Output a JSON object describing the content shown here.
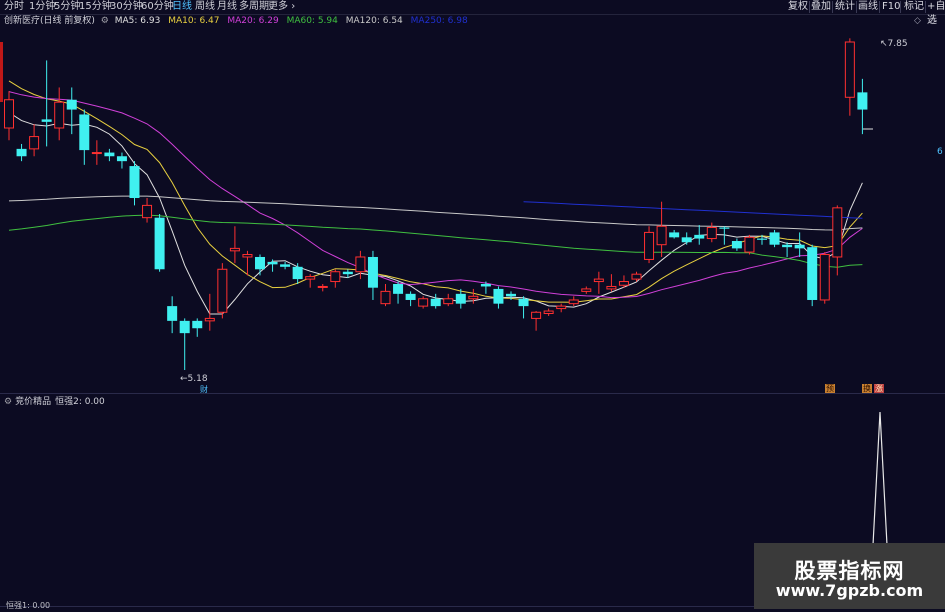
{
  "timeframes": [
    "分时",
    "1分钟",
    "5分钟",
    "15分钟",
    "30分钟",
    "60分钟",
    "日线",
    "周线",
    "月线",
    "多周期",
    "更多"
  ],
  "active_timeframe": "日线",
  "toolbar_right": [
    "复权",
    "叠加",
    "统计",
    "画线",
    "F10",
    "标记",
    "+自选"
  ],
  "title": "创新医疗(日线 前复权)",
  "ma": [
    {
      "label": "MA5: 6.93",
      "color": "#e0e0e0"
    },
    {
      "label": "MA10: 6.47",
      "color": "#e8d040"
    },
    {
      "label": "MA20: 6.29",
      "color": "#d040d8"
    },
    {
      "label": "MA60: 5.94",
      "color": "#40c040"
    },
    {
      "label": "MA120: 6.54",
      "color": "#c8c8c8"
    },
    {
      "label": "MA250: 6.98",
      "color": "#2030d0"
    }
  ],
  "price_high_label": "7.85",
  "price_low_label": "5.18",
  "right_axis_label": "6",
  "event_tag": "财",
  "tags": [
    "预",
    "换",
    "涨"
  ],
  "indicator": {
    "title": "竞价精品",
    "value": "恒强2: 0.00"
  },
  "bottom_text": "恒强1: 0.00",
  "watermark": {
    "line1": "股票指标网",
    "line2": "www.7gpzb.com"
  },
  "colors": {
    "up": "#ff3030",
    "down": "#40f0f0",
    "bg": "#0c0b22"
  },
  "chart_data": {
    "type": "candlestick",
    "candles": [
      [
        7.15,
        7.38,
        7.05,
        7.45
      ],
      [
        6.98,
        6.92,
        6.88,
        7.02
      ],
      [
        6.98,
        7.08,
        6.92,
        7.18
      ],
      [
        7.22,
        7.2,
        7.0,
        7.7
      ],
      [
        7.15,
        7.36,
        7.05,
        7.48
      ],
      [
        7.38,
        7.3,
        7.1,
        7.48
      ],
      [
        7.26,
        6.97,
        6.85,
        7.3
      ],
      [
        6.95,
        6.95,
        6.85,
        7.05
      ],
      [
        6.95,
        6.92,
        6.88,
        6.98
      ],
      [
        6.92,
        6.88,
        6.82,
        6.95
      ],
      [
        6.84,
        6.58,
        6.52,
        6.88
      ],
      [
        6.42,
        6.52,
        6.38,
        6.58
      ],
      [
        6.42,
        6.0,
        5.98,
        6.45
      ],
      [
        5.7,
        5.58,
        5.48,
        5.78
      ],
      [
        5.58,
        5.48,
        5.18,
        5.6
      ],
      [
        5.58,
        5.52,
        5.45,
        5.6
      ],
      [
        5.58,
        5.6,
        5.5,
        5.8
      ],
      [
        5.65,
        6.0,
        5.6,
        6.05
      ],
      [
        6.15,
        6.17,
        6.05,
        6.35
      ],
      [
        6.1,
        6.12,
        5.95,
        6.15
      ],
      [
        6.1,
        6.0,
        5.95,
        6.12
      ],
      [
        6.06,
        6.04,
        5.98,
        6.08
      ],
      [
        6.04,
        6.02,
        6.0,
        6.06
      ],
      [
        6.02,
        5.92,
        5.88,
        6.05
      ],
      [
        5.92,
        5.94,
        5.85,
        5.96
      ],
      [
        5.86,
        5.86,
        5.82,
        5.88
      ],
      [
        5.9,
        5.98,
        5.85,
        6.0
      ],
      [
        5.98,
        5.96,
        5.93,
        6.0
      ],
      [
        5.98,
        6.1,
        5.92,
        6.15
      ],
      [
        6.1,
        5.85,
        5.75,
        6.15
      ],
      [
        5.72,
        5.82,
        5.7,
        5.88
      ],
      [
        5.88,
        5.8,
        5.72,
        5.9
      ],
      [
        5.8,
        5.75,
        5.7,
        5.82
      ],
      [
        5.7,
        5.76,
        5.68,
        5.78
      ],
      [
        5.76,
        5.7,
        5.68,
        5.8
      ],
      [
        5.72,
        5.76,
        5.7,
        5.8
      ],
      [
        5.8,
        5.72,
        5.68,
        5.84
      ],
      [
        5.76,
        5.78,
        5.72,
        5.84
      ],
      [
        5.88,
        5.86,
        5.8,
        5.9
      ],
      [
        5.84,
        5.72,
        5.68,
        5.86
      ],
      [
        5.8,
        5.78,
        5.75,
        5.82
      ],
      [
        5.76,
        5.7,
        5.6,
        5.78
      ],
      [
        5.6,
        5.65,
        5.5,
        5.66
      ],
      [
        5.64,
        5.66,
        5.62,
        5.68
      ],
      [
        5.68,
        5.7,
        5.65,
        5.72
      ],
      [
        5.72,
        5.75,
        5.7,
        5.78
      ],
      [
        5.82,
        5.84,
        5.8,
        5.86
      ],
      [
        5.9,
        5.92,
        5.8,
        5.98
      ],
      [
        5.84,
        5.86,
        5.82,
        5.96
      ],
      [
        5.87,
        5.9,
        5.85,
        5.95
      ],
      [
        5.92,
        5.96,
        5.9,
        5.98
      ],
      [
        6.08,
        6.3,
        6.05,
        6.35
      ],
      [
        6.2,
        6.35,
        6.1,
        6.55
      ],
      [
        6.3,
        6.26,
        6.25,
        6.32
      ],
      [
        6.26,
        6.22,
        6.2,
        6.3
      ],
      [
        6.28,
        6.25,
        6.2,
        6.36
      ],
      [
        6.25,
        6.34,
        6.22,
        6.38
      ],
      [
        6.34,
        6.33,
        6.2,
        6.35
      ],
      [
        6.23,
        6.17,
        6.15,
        6.25
      ],
      [
        6.14,
        6.26,
        6.12,
        6.28
      ],
      [
        6.25,
        6.24,
        6.2,
        6.28
      ],
      [
        6.3,
        6.2,
        6.18,
        6.32
      ],
      [
        6.2,
        6.18,
        6.1,
        6.22
      ],
      [
        6.2,
        6.17,
        6.1,
        6.3
      ],
      [
        6.18,
        5.75,
        5.7,
        6.2
      ],
      [
        5.75,
        6.12,
        5.72,
        6.14
      ],
      [
        6.1,
        6.5,
        5.95,
        6.52
      ],
      [
        7.4,
        7.85,
        7.25,
        7.88
      ],
      [
        7.44,
        7.3,
        7.1,
        7.55
      ]
    ],
    "ma_series": [
      "MA5",
      "MA10",
      "MA20",
      "MA60",
      "MA120",
      "MA250"
    ],
    "price_range": [
      5.18,
      7.85
    ]
  }
}
